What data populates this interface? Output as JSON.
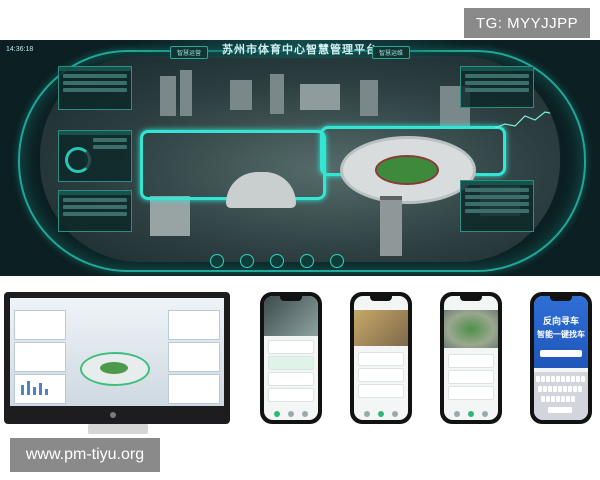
{
  "watermark_top": "TG: MYYJJPP",
  "watermark_bottom": "www.pm-tiyu.org",
  "dashboard": {
    "title": "苏州市体育中心智慧管理平台",
    "time": "14:36:18",
    "tabs": [
      "智慧运营",
      "智慧运维"
    ]
  },
  "colors": {
    "accent": "#32e6d3",
    "frame": "#1fa89a",
    "background": "#0c1f22",
    "phone_blue": "#2f6fd6"
  },
  "phone4": {
    "headline": "反向寻车",
    "subheadline": "智能一键找车"
  }
}
